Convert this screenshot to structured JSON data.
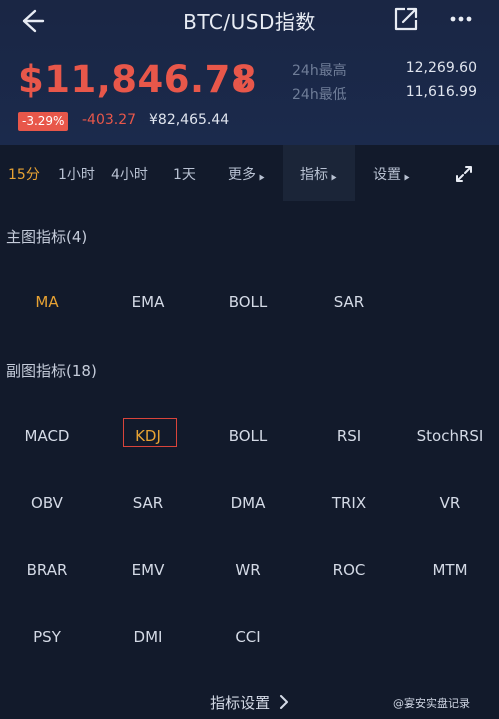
{
  "header": {
    "title": "BTC/USD指数",
    "price": "$11,846.78",
    "change_pct": "-3.29%",
    "change_abs": "-403.27",
    "cny_price": "¥82,465.44",
    "high_label": "24h最高",
    "high_value": "12,269.60",
    "low_label": "24h最低",
    "low_value": "11,616.99",
    "price_color": "#e8574a"
  },
  "toolbar": {
    "intervals": [
      "15分",
      "1小时",
      "4小时",
      "1天"
    ],
    "more": "更多",
    "indicators": "指标",
    "settings": "设置",
    "active_interval": "15分",
    "accent_color": "#e7a233"
  },
  "main": {
    "title": "主图指标(4)",
    "items": [
      "MA",
      "EMA",
      "BOLL",
      "SAR"
    ],
    "selected": "MA"
  },
  "sub": {
    "title": "副图指标(18)",
    "items": [
      "MACD",
      "KDJ",
      "BOLL",
      "RSI",
      "StochRSI",
      "OBV",
      "SAR",
      "DMA",
      "TRIX",
      "VR",
      "BRAR",
      "EMV",
      "WR",
      "ROC",
      "MTM",
      "PSY",
      "DMI",
      "CCI"
    ],
    "selected": "KDJ"
  },
  "footer": {
    "settings_link": "指标设置",
    "watermark": "@宴安实盘记录"
  },
  "icons": [
    "back-arrow-icon",
    "share-icon",
    "more-dots-icon",
    "down-arrow-icon",
    "expand-icon",
    "chevron-right-icon"
  ]
}
